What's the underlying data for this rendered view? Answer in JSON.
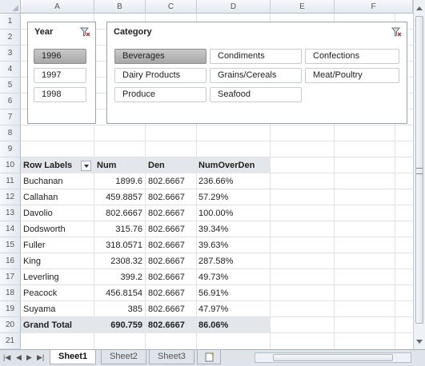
{
  "columns": [
    "A",
    "B",
    "C",
    "D",
    "E",
    "F"
  ],
  "rows": [
    "1",
    "2",
    "3",
    "4",
    "5",
    "6",
    "7",
    "8",
    "9",
    "10",
    "11",
    "12",
    "13",
    "14",
    "15",
    "16",
    "17",
    "18",
    "19",
    "20",
    "21"
  ],
  "year_slicer": {
    "title": "Year",
    "items": [
      {
        "label": "1996",
        "selected": true
      },
      {
        "label": "1997",
        "selected": false
      },
      {
        "label": "1998",
        "selected": false
      }
    ]
  },
  "category_slicer": {
    "title": "Category",
    "items": [
      {
        "label": "Beverages",
        "selected": true
      },
      {
        "label": "Condiments",
        "selected": false
      },
      {
        "label": "Confections",
        "selected": false
      },
      {
        "label": "Dairy Products",
        "selected": false
      },
      {
        "label": "Grains/Cereals",
        "selected": false
      },
      {
        "label": "Meat/Poultry",
        "selected": false
      },
      {
        "label": "Produce",
        "selected": false
      },
      {
        "label": "Seafood",
        "selected": false
      }
    ]
  },
  "pivot": {
    "headers": [
      "Row Labels",
      "Num",
      "Den",
      "NumOverDen"
    ],
    "rows": [
      [
        "Buchanan",
        "1899.6",
        "802.6667",
        "236.66%"
      ],
      [
        "Callahan",
        "459.8857",
        "802.6667",
        "57.29%"
      ],
      [
        "Davolio",
        "802.6667",
        "802.6667",
        "100.00%"
      ],
      [
        "Dodsworth",
        "315.76",
        "802.6667",
        "39.34%"
      ],
      [
        "Fuller",
        "318.0571",
        "802.6667",
        "39.63%"
      ],
      [
        "King",
        "2308.32",
        "802.6667",
        "287.58%"
      ],
      [
        "Leverling",
        "399.2",
        "802.6667",
        "49.73%"
      ],
      [
        "Peacock",
        "456.8154",
        "802.6667",
        "56.91%"
      ],
      [
        "Suyama",
        "385",
        "802.6667",
        "47.97%"
      ]
    ],
    "total": [
      "Grand Total",
      "690.759",
      "802.6667",
      "86.06%"
    ]
  },
  "tabs": [
    "Sheet1",
    "Sheet2",
    "Sheet3"
  ],
  "colors": {
    "selected_chip": "#b3b3b3",
    "header_band": "#e3e6ea"
  }
}
